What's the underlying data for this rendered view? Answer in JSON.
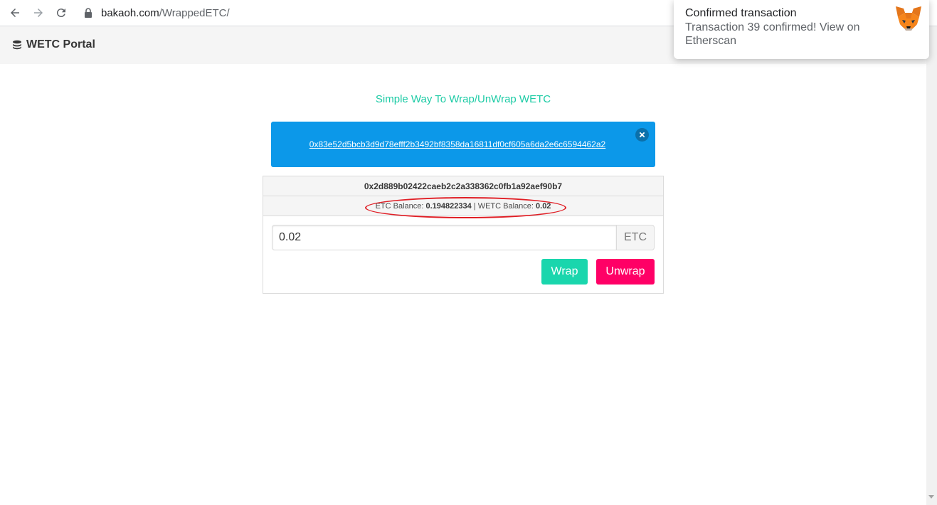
{
  "browser": {
    "url_domain": "bakaoh.com",
    "url_path": "/WrappedETC/"
  },
  "navbar": {
    "brand": "WETC Portal"
  },
  "main": {
    "headline": "Simple Way To Wrap/UnWrap WETC",
    "tx_link": "0x83e52d5bcb3d9d78efff2b3492bf8358da16811df0cf605a6da2e6c6594462a2",
    "account_address": "0x2d889b02422caeb2c2a338362c0fb1a92aef90b7",
    "etc_balance_label": "ETC Balance: ",
    "etc_balance_value": "0.194822334",
    "separator": " | ",
    "wetc_balance_label": "WETC Balance: ",
    "wetc_balance_value": "0.02",
    "amount_value": "0.02",
    "amount_unit": "ETC",
    "wrap_label": "Wrap",
    "unwrap_label": "Unwrap"
  },
  "notification": {
    "title": "Confirmed transaction",
    "body": "Transaction 39 confirmed! View on Etherscan"
  },
  "colors": {
    "accent": "#1ccba5",
    "notify_bg": "#0c98e9",
    "wrap_btn": "#1ad6ad",
    "unwrap_btn": "#ff0066",
    "highlight_ellipse": "#e01e25"
  }
}
